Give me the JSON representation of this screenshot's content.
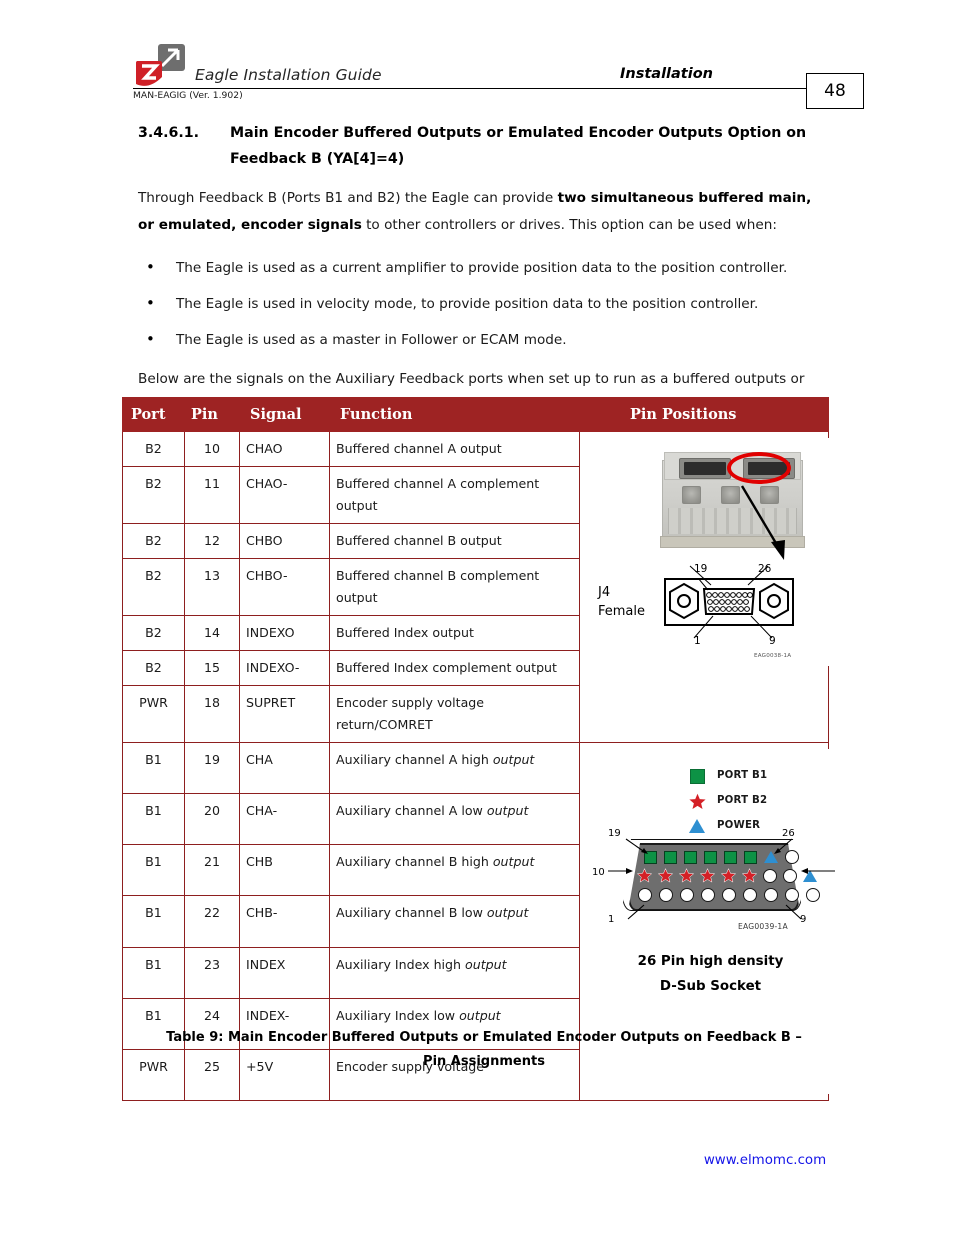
{
  "header": {
    "logo_name": "elmo-logo",
    "doc_title": "Eagle Installation Guide",
    "doc_code": "MAN-EAGIG (Ver. 1.902)",
    "chapter": "Installation",
    "page_number": "48"
  },
  "section": {
    "number": "3.4.6.1.",
    "title": "Main Encoder Buffered Outputs or Emulated Encoder Outputs Option on Feedback B (YA[4]=4)",
    "intro_part1": "Through Feedback B (Ports B1 and B2) the Eagle can provide ",
    "intro_bold": "two simultaneous buffered main, or emulated, encoder signals",
    "intro_part2": " to other controllers or drives. This option can be used when:",
    "bullets": [
      "The Eagle is used as a current amplifier to provide position data to the position controller.",
      "The Eagle is used in velocity mode, to provide position data to the position controller.",
      "The Eagle is used as a master in Follower or ECAM mode."
    ],
    "closing": "Below are the signals on the Auxiliary Feedback ports when set up to run as a buffered outputs or emulated outputs of the main encoder (on Feedback A):"
  },
  "table": {
    "headers": [
      "Port",
      "Pin",
      "Signal",
      "Function",
      "Pin Positions"
    ],
    "header_bg": "#9E2323",
    "border_color": "#8e1f1f",
    "rows": [
      {
        "port": "B2",
        "pin": "10",
        "signal": "CHAO",
        "function": "Buffered channel A output",
        "function_italic": ""
      },
      {
        "port": "B2",
        "pin": "11",
        "signal": "CHAO-",
        "function": "Buffered channel A complement output",
        "function_italic": ""
      },
      {
        "port": "B2",
        "pin": "12",
        "signal": "CHBO",
        "function": "Buffered channel B output",
        "function_italic": ""
      },
      {
        "port": "B2",
        "pin": "13",
        "signal": "CHBO-",
        "function": "Buffered channel B complement output",
        "function_italic": ""
      },
      {
        "port": "B2",
        "pin": "14",
        "signal": "INDEXO",
        "function": "Buffered Index output",
        "function_italic": ""
      },
      {
        "port": "B2",
        "pin": "15",
        "signal": "INDEXO-",
        "function": "Buffered Index complement output",
        "function_italic": ""
      },
      {
        "port": "PWR",
        "pin": "18",
        "signal": "SUPRET",
        "function": "Encoder supply voltage return/COMRET",
        "function_italic": ""
      },
      {
        "port": "B1",
        "pin": "19",
        "signal": "CHA",
        "function": "Auxiliary channel A high ",
        "function_italic": "output"
      },
      {
        "port": "B1",
        "pin": "20",
        "signal": "CHA-",
        "function": "Auxiliary channel A low ",
        "function_italic": "output"
      },
      {
        "port": "B1",
        "pin": "21",
        "signal": "CHB",
        "function": "Auxiliary channel B high ",
        "function_italic": "output"
      },
      {
        "port": "B1",
        "pin": "22",
        "signal": "CHB-",
        "function": "Auxiliary channel B low ",
        "function_italic": "output"
      },
      {
        "port": "B1",
        "pin": "23",
        "signal": "INDEX",
        "function": "Auxiliary Index high ",
        "function_italic": "output"
      },
      {
        "port": "B1",
        "pin": "24",
        "signal": "INDEX-",
        "function": "Auxiliary Index low ",
        "function_italic": "output"
      },
      {
        "port": "PWR",
        "pin": "25",
        "signal": "+5V",
        "function": "Encoder supply voltage",
        "function_italic": ""
      }
    ]
  },
  "figure_top": {
    "name": "drive-photo-and-j4-connector",
    "connector_label_line1": "J4",
    "connector_label_line2": "Female",
    "pin_numbers": {
      "top_left": "19",
      "top_right": "26",
      "bottom_left": "1",
      "bottom_right": "9"
    },
    "drawing_code": "EAG0038-1A",
    "highlight_color": "#e00000"
  },
  "figure_bottom": {
    "name": "26-pin-d-sub-socket-diagram",
    "legend": [
      {
        "symbol": "square",
        "label": "PORT B1",
        "color": "#0d9245"
      },
      {
        "symbol": "star",
        "label": "PORT B2",
        "color": "#d42026"
      },
      {
        "symbol": "triangle",
        "label": "POWER",
        "color": "#2e8fd1"
      }
    ],
    "pin_numbers": {
      "top_left": "19",
      "top_right": "26",
      "mid_left": "10",
      "bottom_left": "1",
      "bottom_right": "9"
    },
    "drawing_code": "EAG0039-1A",
    "caption_line1": "26 Pin high density",
    "caption_line2": "D-Sub Socket",
    "socket_rows": {
      "row_top": [
        "square",
        "square",
        "square",
        "square",
        "square",
        "square",
        "triangle",
        "circle"
      ],
      "row_middle": [
        "star",
        "star",
        "star",
        "star",
        "star",
        "star",
        "circle",
        "circle",
        "triangle"
      ],
      "row_bottom": [
        "circle",
        "circle",
        "circle",
        "circle",
        "circle",
        "circle",
        "circle",
        "circle",
        "circle"
      ]
    }
  },
  "table_caption": {
    "line1": "Table 9: Main Encoder Buffered Outputs or Emulated Encoder Outputs on Feedback B –",
    "line2": "Pin Assignments"
  },
  "footer": {
    "url": "www.elmomc.com",
    "url_color": "#1414e8"
  }
}
